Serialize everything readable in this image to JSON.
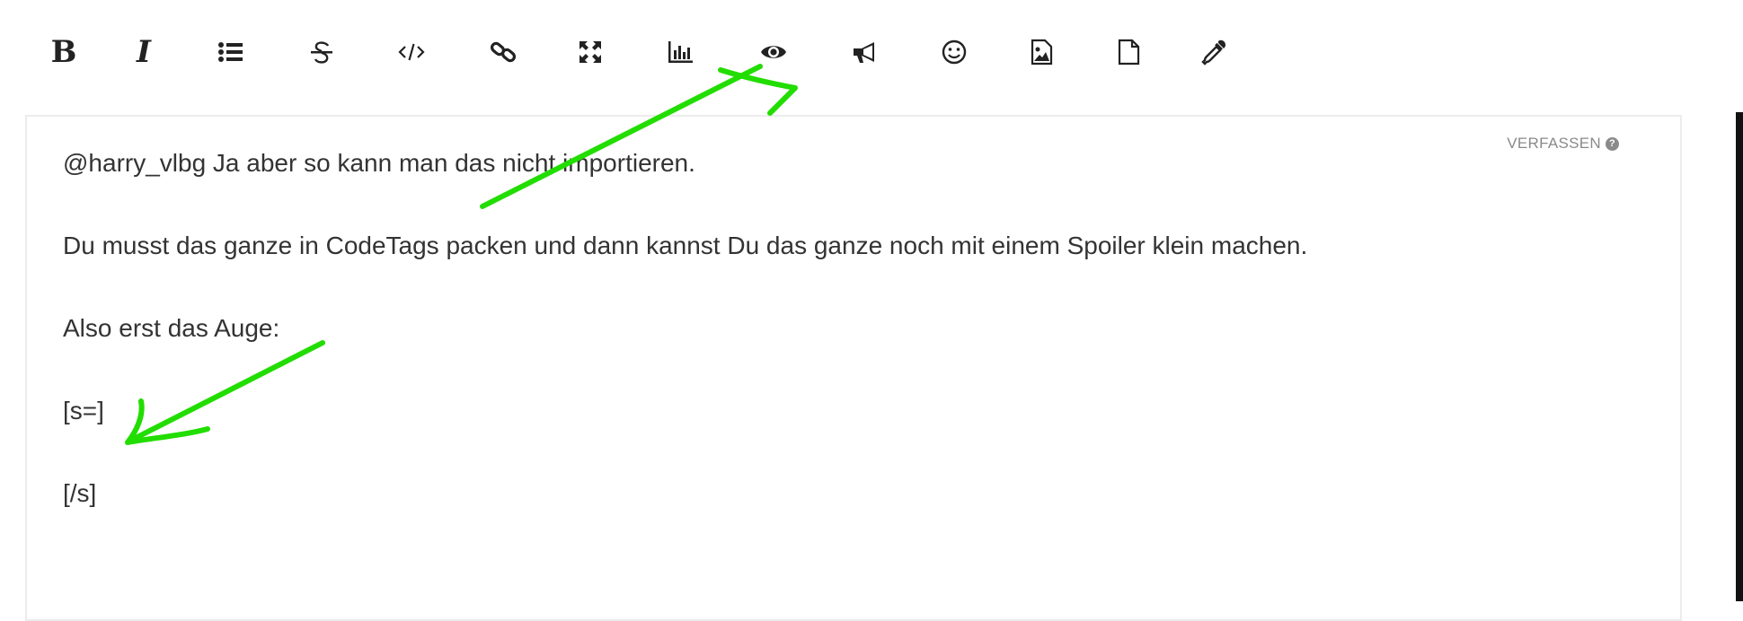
{
  "toolbar": {
    "bold_label": "B",
    "italic_label": "I"
  },
  "editor": {
    "mode_label": "VERFASSEN",
    "help_glyph": "?",
    "lines": [
      "@harry_vlbg Ja aber so kann man das nicht importieren.",
      "Du musst das ganze in CodeTags packen und dann kannst Du das ganze noch mit einem Spoiler klein machen.",
      "Also erst das Auge:",
      "[s=]",
      "[/s]"
    ]
  },
  "icons": [
    "bold",
    "italic",
    "list-icon",
    "strikethrough-icon",
    "code-icon",
    "link-icon",
    "fullscreen-icon",
    "chart-icon",
    "eye-icon",
    "megaphone-icon",
    "smiley-icon",
    "image-icon",
    "file-icon",
    "eyedropper-icon"
  ],
  "annotation_color": "#22dd00"
}
